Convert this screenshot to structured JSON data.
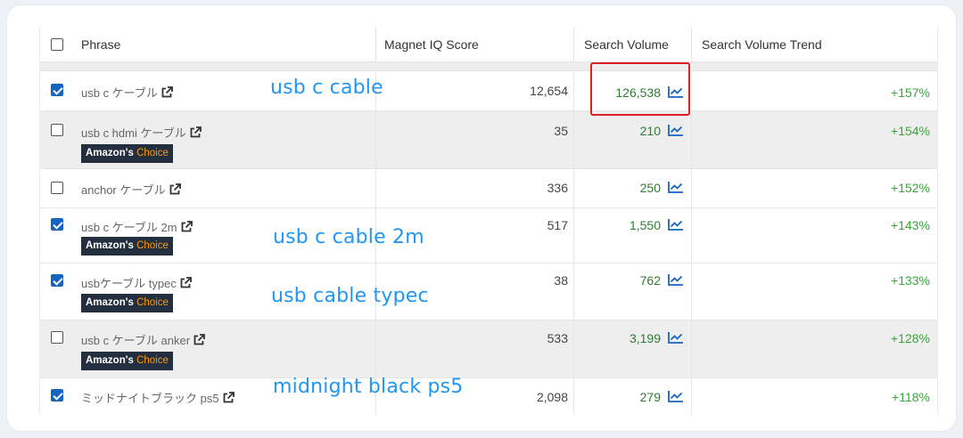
{
  "table": {
    "headers": {
      "phrase": "Phrase",
      "iq_score": "Magnet IQ Score",
      "search_volume": "Search Volume",
      "trend": "Search Volume Trend"
    },
    "badge": {
      "brand": "Amazon's",
      "choice": "Choice"
    },
    "rows": [
      {
        "checked": true,
        "phrase": "usb c ケーブル",
        "iq": "12,654",
        "volume": "126,538",
        "trend": "+157%",
        "badge": false
      },
      {
        "checked": false,
        "phrase": "usb c hdmi ケーブル",
        "iq": "35",
        "volume": "210",
        "trend": "+154%",
        "badge": true
      },
      {
        "checked": false,
        "phrase": "anchor ケーブル",
        "iq": "336",
        "volume": "250",
        "trend": "+152%",
        "badge": false
      },
      {
        "checked": true,
        "phrase": "usb c ケーブル 2m",
        "iq": "517",
        "volume": "1,550",
        "trend": "+143%",
        "badge": true
      },
      {
        "checked": true,
        "phrase": "usbケーブル typec",
        "iq": "38",
        "volume": "762",
        "trend": "+133%",
        "badge": true
      },
      {
        "checked": false,
        "phrase": "usb c ケーブル anker",
        "iq": "533",
        "volume": "3,199",
        "trend": "+128%",
        "badge": true
      },
      {
        "checked": true,
        "phrase": "ミッドナイトブラック ps5",
        "iq": "2,098",
        "volume": "279",
        "trend": "+118%",
        "badge": false
      }
    ]
  },
  "annotations": {
    "row0": "usb c cable",
    "row3": "usb c cable 2m",
    "row4": "usb cable typec",
    "row6": "midnight black ps5"
  },
  "colors": {
    "checkbox_checked": "#1565c0",
    "volume_text": "#2e7d32",
    "trend_text": "#3aa43a",
    "annotation_text": "#2196f3",
    "highlight_box": "#e02020",
    "badge_bg": "#232f3e",
    "badge_choice": "#ff9900"
  }
}
